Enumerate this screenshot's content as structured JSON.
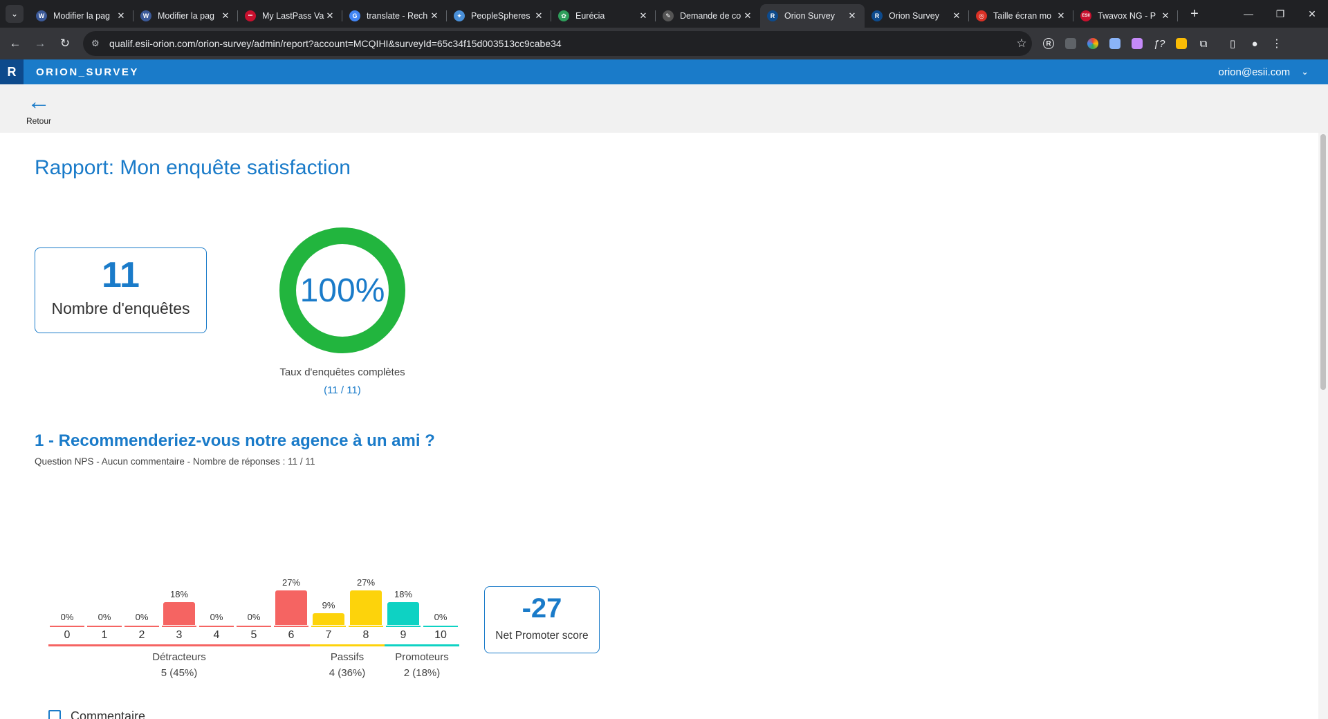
{
  "browser": {
    "tabs": [
      {
        "title": "Modifier la pag",
        "favicon_color": "#3b5998",
        "favicon_glyph": "W",
        "active": false
      },
      {
        "title": "Modifier la pag",
        "favicon_color": "#3b5998",
        "favicon_glyph": "W",
        "active": false
      },
      {
        "title": "My LastPass Va",
        "favicon_color": "#c8102e",
        "favicon_glyph": "•••",
        "active": false
      },
      {
        "title": "translate - Rech",
        "favicon_color": "#4285f4",
        "favicon_glyph": "G",
        "active": false
      },
      {
        "title": "PeopleSpheres",
        "favicon_color": "#4a90d9",
        "favicon_glyph": "✦",
        "active": false
      },
      {
        "title": "Eurécia",
        "favicon_color": "#2e9e5b",
        "favicon_glyph": "✿",
        "active": false
      },
      {
        "title": "Demande de co",
        "favicon_color": "#555555",
        "favicon_glyph": "✎",
        "active": false
      },
      {
        "title": "Orion Survey",
        "favicon_color": "#0d4a8c",
        "favicon_glyph": "R",
        "active": true
      },
      {
        "title": "Orion Survey",
        "favicon_color": "#0d4a8c",
        "favicon_glyph": "R",
        "active": false
      },
      {
        "title": "Taille écran mo",
        "favicon_color": "#d93025",
        "favicon_glyph": "◎",
        "active": false
      },
      {
        "title": "Twavox NG - P",
        "favicon_color": "#c8102e",
        "favicon_glyph": "ESII",
        "active": false
      }
    ],
    "url": "qualif.esii-orion.com/orion-survey/admin/report?account=MCQIHI&surveyId=65c34f15d003513cc9cabe34"
  },
  "app": {
    "logo": "R",
    "brand": "ORION_SURVEY",
    "user_email": "orion@esii.com",
    "back_label": "Retour"
  },
  "report": {
    "title": "Rapport: Mon enquête satisfaction",
    "survey_count": "11",
    "survey_count_label": "Nombre d'enquêtes",
    "completion_rate": 1.0,
    "completion_text": "100%",
    "completion_caption": "Taux d'enquêtes complètes",
    "completion_fraction": "(11 / 11)"
  },
  "question": {
    "title": "1 - Recommenderiez-vous notre agence à un ami ?",
    "subtitle": "Question NPS - Aucun commentaire - Nombre de réponses : 11 / 11",
    "comment_label": "Commentaire"
  },
  "colors": {
    "accent": "#1a7bc9",
    "detractor": "#f56462",
    "passive": "#fdd30b",
    "promoter": "#0ed2c3",
    "donut": "#22b53e"
  },
  "chart_data": {
    "type": "bar",
    "categories": [
      "0",
      "1",
      "2",
      "3",
      "4",
      "5",
      "6",
      "7",
      "8",
      "9",
      "10"
    ],
    "values": [
      0,
      0,
      0,
      18,
      0,
      0,
      27,
      9,
      27,
      18,
      0
    ],
    "value_labels": [
      "0%",
      "0%",
      "0%",
      "18%",
      "0%",
      "0%",
      "27%",
      "9%",
      "27%",
      "18%",
      "0%"
    ],
    "groups": [
      {
        "name": "Détracteurs",
        "value": "5 (45%)",
        "from": 0,
        "to": 6,
        "color": "#f56462"
      },
      {
        "name": "Passifs",
        "value": "4 (36%)",
        "from": 7,
        "to": 8,
        "color": "#fdd30b"
      },
      {
        "name": "Promoteurs",
        "value": "2 (18%)",
        "from": 9,
        "to": 10,
        "color": "#0ed2c3"
      }
    ],
    "ylim": [
      0,
      27
    ],
    "nps_score": "-27",
    "nps_label": "Net Promoter score"
  }
}
